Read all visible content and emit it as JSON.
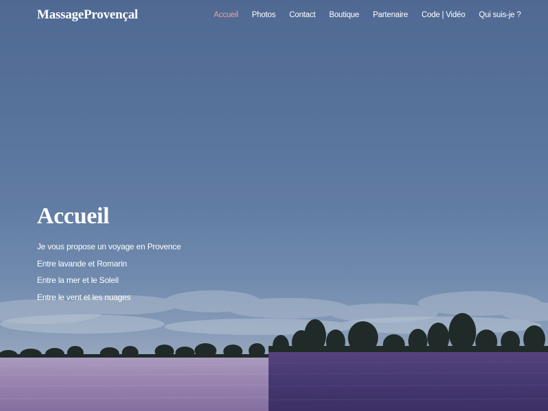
{
  "brand": {
    "name": "MassageProvençal"
  },
  "nav": {
    "items": [
      {
        "label": "Accueil",
        "active": true
      },
      {
        "label": "Photos",
        "active": false
      },
      {
        "label": "Contact",
        "active": false
      },
      {
        "label": "Boutique",
        "active": false
      },
      {
        "label": "Partenaire",
        "active": false
      },
      {
        "label": "Code | Vidéo",
        "active": false
      },
      {
        "label": "Qui suis-je ?",
        "active": false
      }
    ]
  },
  "hero": {
    "title": "Accueil",
    "lines": [
      "Je vous propose un voyage en Provence",
      "Entre lavande et Romarin",
      "Entre la mer et le Soleil",
      "Entre le vent et les nuages"
    ]
  },
  "colors": {
    "nav_active": "#f0a0a0",
    "text": "#ffffff",
    "sky": "#5f7aa0",
    "lavender_light": "#a28bb7",
    "lavender_dark": "#4b3a74"
  },
  "background": {
    "image": "lavender-field-landscape"
  }
}
